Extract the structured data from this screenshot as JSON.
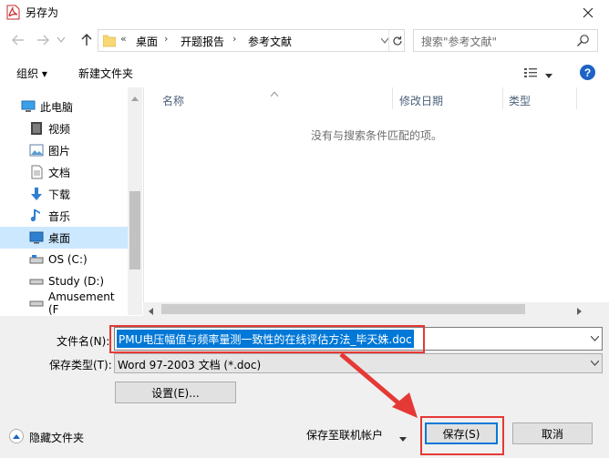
{
  "title_bar": {
    "title": "另存为"
  },
  "address": {
    "prefix": "«",
    "crumbs": [
      "桌面",
      "开题报告",
      "参考文献"
    ]
  },
  "search": {
    "placeholder": "搜索\"参考文献\""
  },
  "toolbar": {
    "organize": "组织 ▾",
    "new_folder": "新建文件夹"
  },
  "nav_pane": {
    "items": [
      {
        "label": "此电脑",
        "icon": "computer-icon"
      },
      {
        "label": "视频",
        "icon": "video-icon"
      },
      {
        "label": "图片",
        "icon": "pictures-icon"
      },
      {
        "label": "文档",
        "icon": "documents-icon"
      },
      {
        "label": "下载",
        "icon": "download-icon"
      },
      {
        "label": "音乐",
        "icon": "music-icon"
      },
      {
        "label": "桌面",
        "icon": "desktop-icon"
      },
      {
        "label": "OS (C:)",
        "icon": "drive-icon"
      },
      {
        "label": "Study (D:)",
        "icon": "drive-icon"
      },
      {
        "label": "Amusement (F",
        "icon": "drive-icon"
      }
    ]
  },
  "file_list": {
    "columns": [
      "名称",
      "修改日期",
      "类型"
    ],
    "empty_message": "没有与搜索条件匹配的项。"
  },
  "form": {
    "filename_label": "文件名(N):",
    "filename_value": "PMU电压幅值与频率量测一致性的在线评估方法_毕天姝.doc",
    "type_label": "保存类型(T):",
    "type_value": "Word 97-2003 文档 (*.doc)",
    "settings_button": "设置(E)..."
  },
  "footer": {
    "hide_folders": "隐藏文件夹",
    "save_to_online": "保存至联机帐户",
    "save_button": "保存(S)",
    "cancel_button": "取消"
  },
  "colors": {
    "selection": "#0078d7",
    "annotation": "#e53935",
    "nav_selected": "#cce8ff"
  }
}
